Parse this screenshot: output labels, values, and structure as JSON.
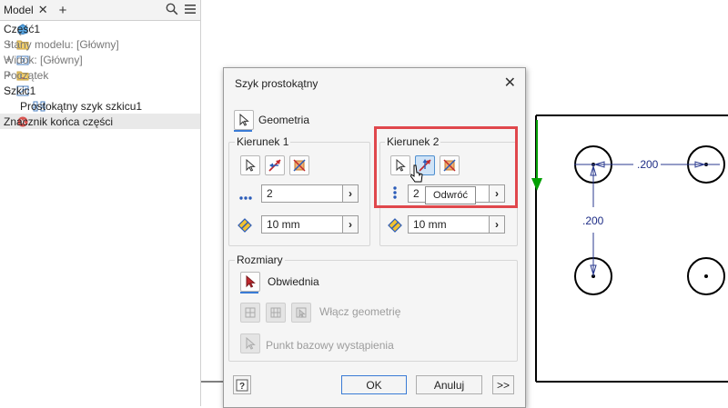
{
  "browser": {
    "tab_label": "Model",
    "tree": [
      {
        "label": "Część1",
        "icon": "part-icon",
        "expander": "",
        "indent": 0,
        "grey": false,
        "dim": false
      },
      {
        "label": "Stany modelu: [Główny]",
        "icon": "folder-icon",
        "expander": "+",
        "indent": 0,
        "grey": false,
        "dim": true
      },
      {
        "label": "Widok: [Główny]",
        "icon": "view-icon",
        "expander": "+",
        "indent": 0,
        "grey": false,
        "dim": true
      },
      {
        "label": "Początek",
        "icon": "origin-folder-icon",
        "expander": "+",
        "indent": 0,
        "grey": false,
        "dim": true
      },
      {
        "label": "Szkic1",
        "icon": "sketch-icon",
        "expander": "−",
        "indent": 0,
        "grey": false,
        "dim": false
      },
      {
        "label": "Prostokątny szyk szkicu1",
        "icon": "pattern-icon",
        "expander": "",
        "indent": 1,
        "grey": false,
        "dim": false
      },
      {
        "label": "Znacznik końca części",
        "icon": "end-of-part-icon",
        "expander": "",
        "indent": 0,
        "grey": true,
        "dim": false
      }
    ]
  },
  "dialog": {
    "title": "Szyk prostokątny",
    "geometry_label": "Geometria",
    "direction1": {
      "title": "Kierunek 1",
      "count": "2",
      "spacing": "10 mm"
    },
    "direction2": {
      "title": "Kierunek 2",
      "count": "2",
      "spacing": "10 mm"
    },
    "tooltip": "Odwróć",
    "sizes": {
      "title": "Rozmiary",
      "boundary_label": "Obwiednia",
      "include_geometry_label": "Włącz geometrię",
      "base_point_label": "Punkt bazowy wystąpienia"
    },
    "ok_label": "OK",
    "cancel_label": "Anuluj",
    "more_label": ">>"
  },
  "sketch": {
    "dim_horizontal": ".200",
    "dim_vertical": ".200"
  },
  "colors": {
    "highlight": "#e0474c",
    "selected_button": "#cfe3f7",
    "axis_green": "#00a000"
  }
}
